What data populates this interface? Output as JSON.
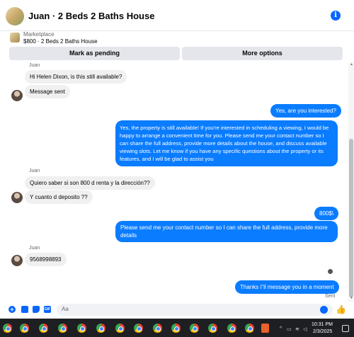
{
  "header": {
    "title": "Juan · 2 Beds 2 Baths House",
    "info_glyph": "i"
  },
  "listing": {
    "label": "Marketplace",
    "summary": "$800 · 2 Beds 2 Baths House"
  },
  "actions": {
    "pending_label": "Mark as pending",
    "more_label": "More options"
  },
  "messages": [
    {
      "from": "Juan",
      "sender_label": "Juan",
      "text": "Hi Helen Dixon, is this still available?",
      "dir": "in"
    },
    {
      "from": "Juan",
      "text": "Message sent",
      "dir": "in"
    },
    {
      "from": "me",
      "text": "Yes, are you interested?",
      "dir": "out"
    },
    {
      "from": "me",
      "text": "Yes, the property is still available! If you're interested in scheduling a viewing, I would be happy to arrange a convenient time for you. Please send me your contact number so I can share the full address, provide more details about the house, and discuss available viewing slots. Let me know if you have any specific questions about the property or its features, and I will be glad to assist you",
      "dir": "out"
    },
    {
      "from": "Juan",
      "sender_label": "Juan",
      "text": "Quiero saber si son 800 d renta y la dirección??",
      "dir": "in"
    },
    {
      "from": "Juan",
      "text": "Y cuanto d deposito ??",
      "dir": "in"
    },
    {
      "from": "me",
      "text": "800$\\",
      "dir": "out"
    },
    {
      "from": "me",
      "text": "Please send me your contact number so I can share the full address, provide more details",
      "dir": "out"
    },
    {
      "from": "Juan",
      "sender_label": "Juan",
      "text": "9568998893",
      "dir": "in"
    },
    {
      "from": "me",
      "text": "Thanks i\"il message you in a moment",
      "dir": "out"
    }
  ],
  "sent_status": "Sent",
  "compose": {
    "placeholder": "Aa",
    "icons": [
      "plus-icon",
      "photo-icon",
      "sticker-icon",
      "gif-icon",
      "emoji-icon",
      "like-icon"
    ],
    "gif_label": "GIF"
  },
  "taskbar": {
    "time": "10:31 PM",
    "date": "2/3/2025",
    "tray_caret": "^"
  },
  "colors": {
    "accent": "#0866ff",
    "outgoing_bubble": "#0a7cff",
    "incoming_bubble": "#f0f0f0",
    "taskbar": "#1e1f22"
  }
}
